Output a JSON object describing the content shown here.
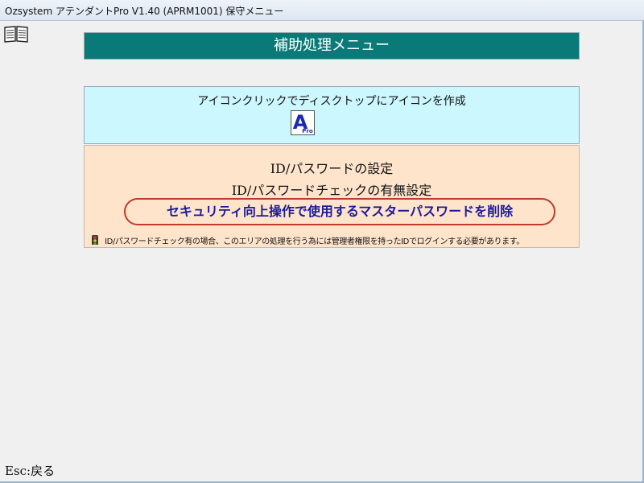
{
  "window": {
    "title": "Ozsystem アテンダントPro V1.40 (APRM1001) 保守メニュー"
  },
  "toolbar": {
    "manual_icon": "open-book-icon"
  },
  "header": {
    "title": "補助処理メニュー"
  },
  "icon_panel": {
    "label": "アイコンクリックでディスクトップにアイコンを作成",
    "app_icon": {
      "letter": "A",
      "sub": "Pro"
    }
  },
  "security_panel": {
    "items": [
      "ID/パスワードの設定",
      "ID/パスワードチェックの有無設定"
    ],
    "delete_button": "セキュリティ向上操作で使用するマスターパスワードを削除",
    "note": "ID/パスワードチェック有の場合、このエリアの処理を行う為には管理者権限を持ったIDでログインする必要があります。",
    "note_icon": "traffic-signal-icon"
  },
  "footer": {
    "esc_label": "Esc:戻る"
  },
  "colors": {
    "header_bg": "#0a7a78",
    "icon_panel_bg": "#ccf7ff",
    "security_panel_bg": "#ffe4cc",
    "delete_border": "#c0392b",
    "delete_text": "#1a1aa0"
  }
}
